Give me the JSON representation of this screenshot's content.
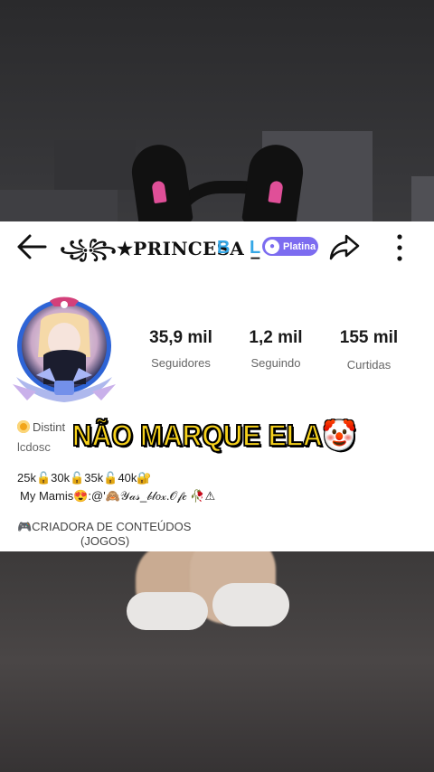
{
  "header": {
    "username": "꧁꧂★PRINCESA _",
    "suffix": "B L",
    "badge_label": "Platina",
    "icons": {
      "back": "arrow-left-icon",
      "share": "share-arrow-icon",
      "more": "more-vertical-icon",
      "badge": "badge-people-icon"
    }
  },
  "stats": [
    {
      "value": "35,9 mil",
      "label": "Seguidores"
    },
    {
      "value": "1,2 mil",
      "label": "Seguindo"
    },
    {
      "value": "155 mil",
      "label": "Curtidas"
    }
  ],
  "distinction": {
    "label": "Distint",
    "icon": "hexagon-badge-icon"
  },
  "handle_partial": "lcdosc",
  "bio": {
    "line1": "25k🔓30k🔓35k🔓40k🔐",
    "line2": "My Mamis😍:@'🙈𝒴𝒶𝓈_𝒷𝓁𝑜𝓍.𝒪𝒻𝒸 🥀⚠"
  },
  "category": {
    "line1": "🎮CRIADORA DE CONTEÚDOS",
    "line2": "(JOGOS)"
  },
  "overlay_caption": "NÃO MARQUE ELA🤡",
  "colors": {
    "badge": "#7c6cf0",
    "accent_blue": "#35a7e6",
    "caption": "#f7d21b"
  }
}
